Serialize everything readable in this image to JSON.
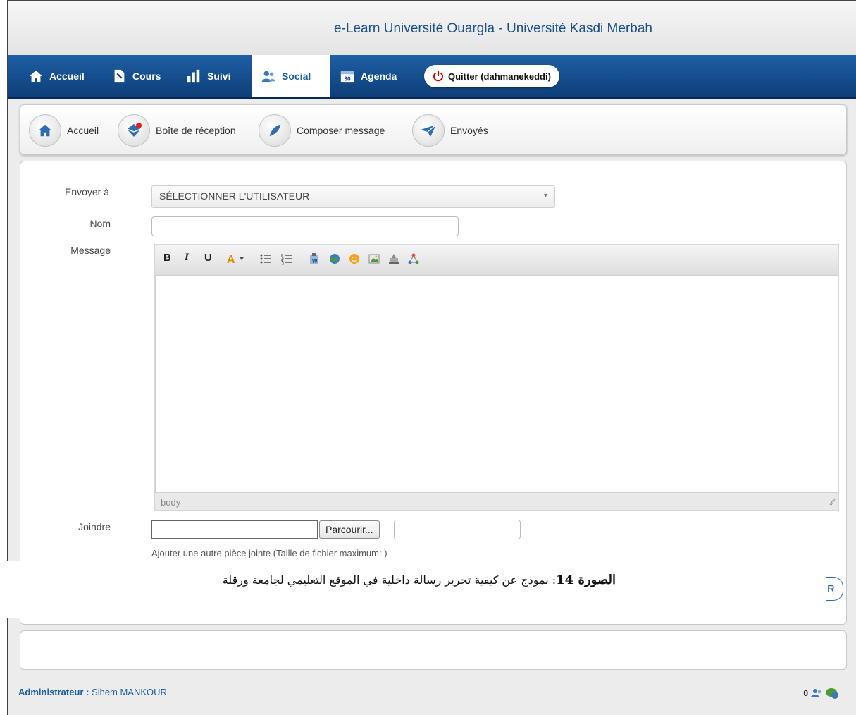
{
  "header": {
    "title": "e-Learn Université Ouargla - Université Kasdi Merbah"
  },
  "nav": {
    "items": [
      {
        "label": "Accueil",
        "icon": "home-icon"
      },
      {
        "label": "Cours",
        "icon": "document-icon"
      },
      {
        "label": "Suivi",
        "icon": "bar-chart-icon"
      },
      {
        "label": "Social",
        "icon": "users-icon",
        "active": true
      },
      {
        "label": "Agenda",
        "icon": "calendar-icon",
        "day": "30"
      }
    ],
    "quit_label": "Quitter (dahmanekeddi)"
  },
  "subnav": {
    "items": [
      {
        "label": "Accueil",
        "icon": "home-icon"
      },
      {
        "label": "Boîte de réception",
        "icon": "inbox-icon"
      },
      {
        "label": "Composer message",
        "icon": "feather-icon"
      },
      {
        "label": "Envoyés",
        "icon": "paper-plane-icon"
      }
    ]
  },
  "form": {
    "to_label": "Envoyer à",
    "to_value": "SÉLECTIONNER L'UTILISATEUR",
    "name_label": "Nom",
    "message_label": "Message",
    "editor_path": "body",
    "attach_label": "Joindre",
    "browse_label": "Parcourir...",
    "help_text": "Ajouter une autre pièce jointe (Taille de fichier maximum: )",
    "partial_button": "R"
  },
  "toolbar": {
    "bold": "B",
    "italic": "I",
    "underline": "U"
  },
  "caption": {
    "number_label": "الصورة 14",
    "text": ": نموذج عن كيفية تحرير رسالة داخلية في الموقع التعليمي لجامعة ورقلة"
  },
  "footer": {
    "role": "Administrateur :",
    "user": "Sihem MANKOUR",
    "count": "0"
  },
  "colors": {
    "nav_blue": "#1e5fa4",
    "title_blue": "#1b4f8a"
  }
}
